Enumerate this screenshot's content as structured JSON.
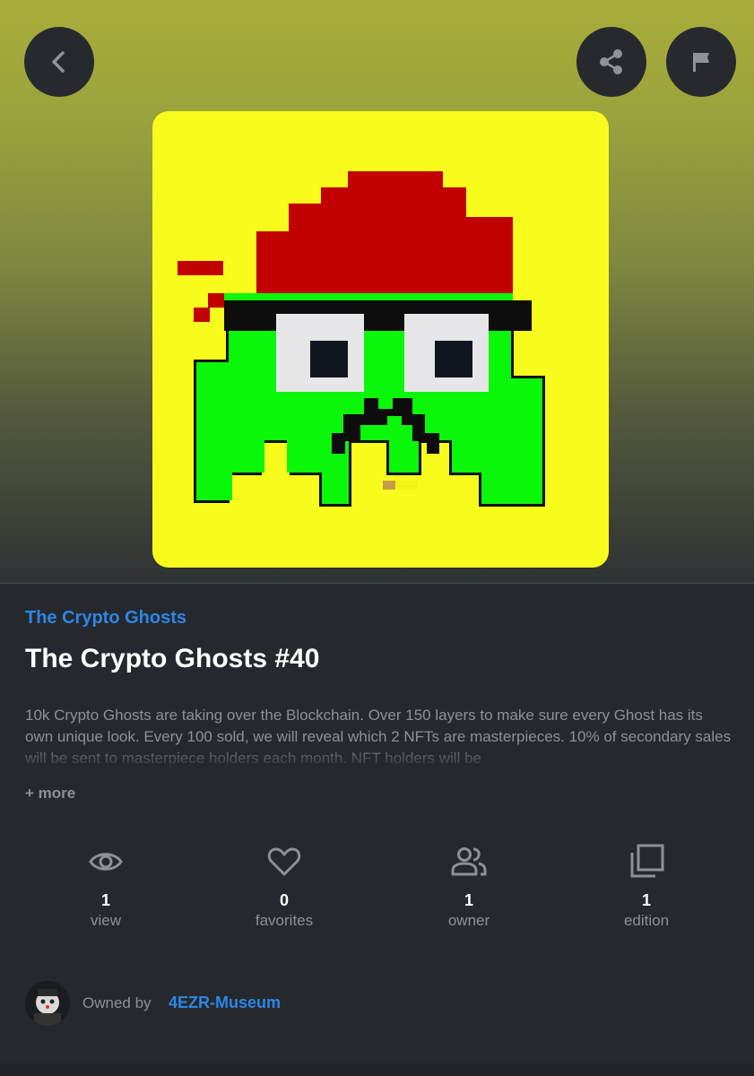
{
  "header": {
    "back_icon": "chevron-left-icon",
    "share_icon": "share-icon",
    "report_icon": "flag-icon"
  },
  "nft": {
    "image_alt": "pixel-art green ghost with red bandana, sunglasses and mustache on yellow background",
    "background_color": "#f8fc1d"
  },
  "collection_name": "The Crypto Ghosts",
  "title": "The Crypto Ghosts #40",
  "description": "10k Crypto Ghosts are taking over the Blockchain. Over 150 layers to make sure every Ghost has its own unique look. Every 100 sold, we will reveal which 2 NFTs are masterpieces. 10% of secondary sales will be sent to masterpiece holders each month. NFT holders will be",
  "more_label": "+ more",
  "stats": [
    {
      "icon": "eye-icon",
      "value": "1",
      "label": "view"
    },
    {
      "icon": "heart-icon",
      "value": "0",
      "label": "favorites"
    },
    {
      "icon": "users-icon",
      "value": "1",
      "label": "owner"
    },
    {
      "icon": "copies-icon",
      "value": "1",
      "label": "edition"
    }
  ],
  "owner": {
    "prefix": "Owned by",
    "name": "4EZR-Museum",
    "avatar_icon": "avatar"
  },
  "colors": {
    "accent": "#2d86e6",
    "background": "#25282d",
    "muted_text": "#8d9197"
  }
}
